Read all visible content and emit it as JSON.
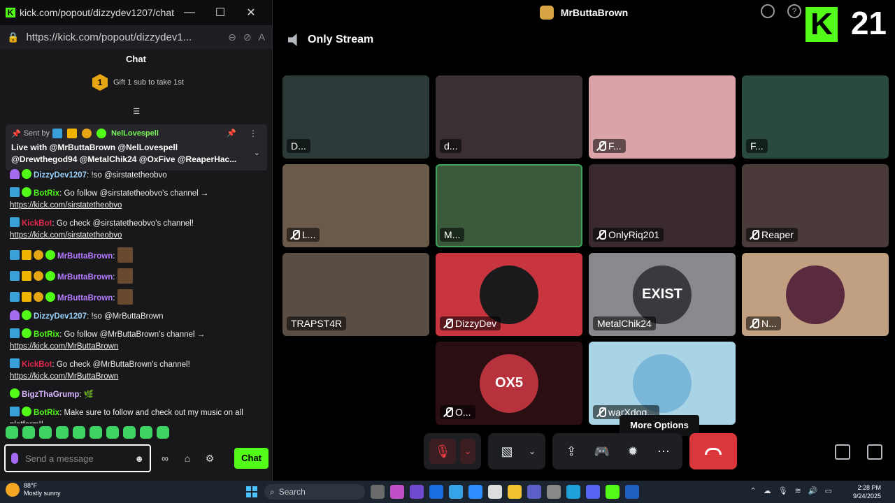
{
  "chat_window": {
    "title": "kick.com/popout/dizzydev1207/chat...",
    "url": "https://kick.com/popout/dizzydev1...",
    "header": "Chat",
    "gift_text": "Gift 1 sub to take 1st",
    "gift_rank": "1",
    "pinned": {
      "sent_by_label": "Sent by",
      "sender": "NelLovespell",
      "text_line1": "Live with @MrButtaBrown @NelLovespell",
      "text_line2": "@Drewthegod94 @MetalChik24 @OxFive @ReaperHac..."
    },
    "messages": [
      {
        "user": "DizzyDev1207",
        "text": " !so @sirstatetheobvo",
        "link": "",
        "color": "u-blue",
        "badges": [
          "b-purple",
          "b-green"
        ]
      },
      {
        "user": "BotRix",
        "text": " Go follow @sirstatetheobvo's channel →",
        "link": "https://kick.com/sirstatetheobvo",
        "color": "u-green",
        "badges": [
          "b-blue",
          "b-green"
        ]
      },
      {
        "user": "KickBot",
        "text": " Go check @sirstatetheobvo's channel!",
        "link": "https://kick.com/sirstatetheobvo",
        "color": "u-red",
        "badges": [
          "b-blue"
        ]
      },
      {
        "user": "MrButtaBrown",
        "text": "",
        "link": "",
        "color": "u-purple",
        "badges": [
          "b-blue",
          "b-crown",
          "b-one",
          "b-green"
        ],
        "emote": true
      },
      {
        "user": "MrButtaBrown",
        "text": "",
        "link": "",
        "color": "u-purple",
        "badges": [
          "b-blue",
          "b-crown",
          "b-one",
          "b-green"
        ],
        "emote": true
      },
      {
        "user": "MrButtaBrown",
        "text": "",
        "link": "",
        "color": "u-purple",
        "badges": [
          "b-blue",
          "b-crown",
          "b-one",
          "b-green"
        ],
        "emote": true
      },
      {
        "user": "DizzyDev1207",
        "text": " !so @MrButtaBrown",
        "link": "",
        "color": "u-blue",
        "badges": [
          "b-purple",
          "b-green"
        ]
      },
      {
        "user": "BotRix",
        "text": " Go follow @MrButtaBrown's channel →",
        "link": "https://kick.com/MrButtaBrown",
        "color": "u-green",
        "badges": [
          "b-blue",
          "b-green"
        ]
      },
      {
        "user": "KickBot",
        "text": " Go check @MrButtaBrown's channel!",
        "link": "https://kick.com/MrButtaBrown",
        "color": "u-red",
        "badges": [
          "b-blue"
        ]
      },
      {
        "user": "BigzThaGrump",
        "text": " 🌿",
        "link": "",
        "color": "u-lilac",
        "badges": [
          "b-green"
        ]
      },
      {
        "user": "BotRix",
        "text": " Make sure to follow and check out my music on all platform!!",
        "link": "",
        "color": "u-green",
        "badges": [
          "b-blue",
          "b-green"
        ]
      }
    ],
    "input_placeholder": "Send a message",
    "send_label": "Chat"
  },
  "call_window": {
    "server_title": "MrButtaBrown",
    "channel_name": "Only Stream",
    "viewer_count": "21",
    "kick_logo": "K",
    "tooltip": "More Options",
    "participants": [
      {
        "label": "D...",
        "muted": false,
        "bg": "#2c3a3a"
      },
      {
        "label": "d...",
        "muted": false,
        "bg": "#3a3032"
      },
      {
        "label": "F...",
        "muted": true,
        "bg": "#d9a3a8"
      },
      {
        "label": "F...",
        "muted": false,
        "bg": "#2a4a3e"
      },
      {
        "label": "L...",
        "muted": true,
        "bg": "#6a5a4a"
      },
      {
        "label": "M...",
        "muted": false,
        "bg": "#3a5a3a",
        "speaking": true
      },
      {
        "label": "OnlyRiq201",
        "muted": true,
        "bg": "#3a2a2e"
      },
      {
        "label": "Reaper",
        "muted": true,
        "bg": "#4a3a3a"
      },
      {
        "label": "TRAPST4R",
        "muted": false,
        "bg": "#5a4e44"
      },
      {
        "label": "DizzyDev",
        "muted": true,
        "bg": "#c8353f",
        "avatar_text": "",
        "avatar_bg": "#1a1a1a"
      },
      {
        "label": "MetalChik24",
        "muted": false,
        "bg": "#8a8a8e",
        "avatar_text": "EXIST",
        "avatar_bg": "#3a3a3e"
      },
      {
        "label": "N...",
        "muted": true,
        "bg": "#c0a080",
        "avatar_text": "",
        "avatar_bg": "#5a2a3e"
      },
      {
        "label": "O...",
        "muted": true,
        "bg": "#2a0e12",
        "avatar_text": "OX5",
        "avatar_bg": "#b8323e"
      },
      {
        "label": "warXdog...",
        "muted": true,
        "bg": "#a9d4e6",
        "avatar_text": "",
        "avatar_bg": "#7ab6d8"
      }
    ]
  },
  "taskbar": {
    "weather_temp": "88°F",
    "weather_desc": "Mostly sunny",
    "search_placeholder": "Search",
    "time": "2:28 PM",
    "date": "9/24/2025"
  }
}
